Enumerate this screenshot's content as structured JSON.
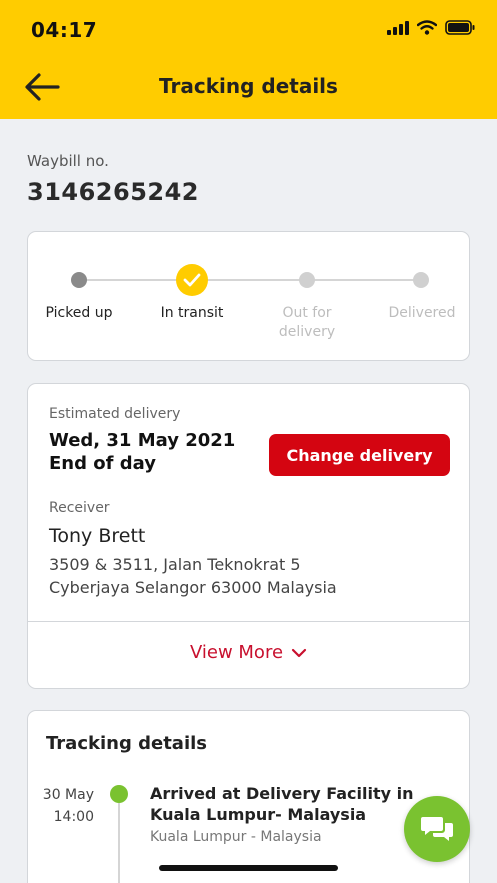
{
  "status_bar": {
    "time": "04:17"
  },
  "header": {
    "title": "Tracking details"
  },
  "waybill": {
    "label": "Waybill no.",
    "number": "3146265242"
  },
  "progress": {
    "steps": [
      {
        "label": "Picked up",
        "state": "done"
      },
      {
        "label": "In transit",
        "state": "current"
      },
      {
        "label": "Out for delivery",
        "state": "pending"
      },
      {
        "label": "Delivered",
        "state": "pending"
      }
    ]
  },
  "delivery": {
    "estimated_label": "Estimated delivery",
    "date_line1": "Wed, 31 May 2021",
    "date_line2": "End of day",
    "change_button": "Change delivery",
    "receiver_label": "Receiver",
    "receiver_name": "Tony Brett",
    "address_line1": "3509 & 3511, Jalan Teknokrat 5",
    "address_line2": "Cyberjaya Selangor 63000 Malaysia",
    "view_more": "View More"
  },
  "tracking": {
    "title": "Tracking details",
    "events": [
      {
        "date": "30 May",
        "time": "14:00",
        "title": "Arrived at Delivery Facility in Kuala Lumpur- Malaysia",
        "location": "Kuala Lumpur - Malaysia"
      }
    ]
  },
  "colors": {
    "brand_yellow": "#ffcc00",
    "brand_red": "#d40511",
    "success_green": "#7ac230"
  }
}
